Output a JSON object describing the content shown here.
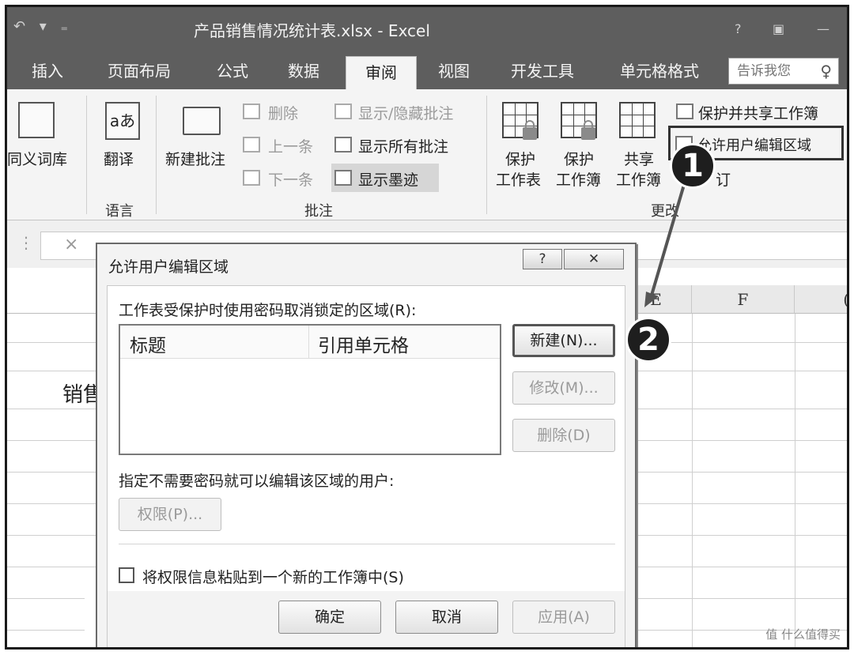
{
  "window": {
    "qat": "↶ ▾ ₌",
    "title": "产品销售情况统计表.xlsx - Excel",
    "help": "?",
    "restore": "▣",
    "minimize": "—"
  },
  "tabs": [
    {
      "label": "插入"
    },
    {
      "label": "页面布局"
    },
    {
      "label": "公式"
    },
    {
      "label": "数据"
    },
    {
      "label": "审阅",
      "active": true
    },
    {
      "label": "视图"
    },
    {
      "label": "开发工具"
    },
    {
      "label": "单元格格式"
    }
  ],
  "tell_me": {
    "placeholder": "告诉我您"
  },
  "ribbon": {
    "thesaurus": "同义词库",
    "translate": "翻译",
    "language_group": "语言",
    "new_comment": "新建批注",
    "delete": "删除",
    "previous": "上一条",
    "next": "下一条",
    "show_hide_comment": "显示/隐藏批注",
    "show_all_comments": "显示所有批注",
    "show_ink": "显示墨迹",
    "comments_group": "批注",
    "protect_sheet": [
      "保护",
      "工作表"
    ],
    "protect_workbook": [
      "保护",
      "工作簿"
    ],
    "share_workbook": [
      "共享",
      "工作簿"
    ],
    "protect_share": "保护并共享工作簿",
    "allow_edit_ranges": "允许用户编辑区域",
    "track_changes": "订",
    "changes_group": "更改"
  },
  "formula_bar": {
    "cancel": "×",
    "dots": "⋮"
  },
  "sheet": {
    "columns": [
      {
        "label": "E"
      },
      {
        "label": "F"
      },
      {
        "label": "("
      }
    ],
    "cell_text": "销售"
  },
  "dialog": {
    "title": "允许用户编辑区域",
    "help": "?",
    "close": "✕",
    "ranges_label": "工作表受保护时使用密码取消锁定的区域(R):",
    "col_title": "标题",
    "col_refers": "引用单元格",
    "new_button": "新建(N)...",
    "modify_button": "修改(M)...",
    "delete_button": "删除(D)",
    "users_label": "指定不需要密码就可以编辑该区域的用户:",
    "permissions_button": "权限(P)...",
    "paste_checkbox": "将权限信息粘贴到一个新的工作簿中(S)",
    "ok_button": "确定",
    "cancel_button": "取消",
    "apply_button": "应用(A)"
  },
  "annotations": {
    "step1": "1",
    "step2": "2"
  },
  "watermark": "值 什么值得买"
}
